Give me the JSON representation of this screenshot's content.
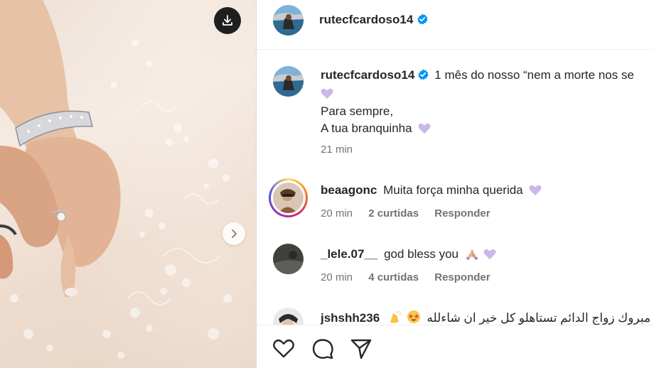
{
  "post": {
    "author": "rutecfcardoso14",
    "caption_line1": "1 mês do nosso “nem a morte nos se",
    "caption_line2": "Para sempre,",
    "caption_line3": "A tua branquinha",
    "time": "21 min"
  },
  "comments": [
    {
      "username": "beaagonc",
      "text": "Muita força minha querida",
      "time": "20 min",
      "likes": "2 curtidas",
      "reply": "Responder"
    },
    {
      "username": "_lele.07__",
      "text": "god bless you",
      "time": "20 min",
      "likes": "4 curtidas",
      "reply": "Responder"
    },
    {
      "username": "jshshh236",
      "text": "مبروك زواج الدائم تستاهلو كل خير ان شاءلله"
    }
  ],
  "icons": {
    "download": "download-icon",
    "next": "chevron-right-icon",
    "verified": "verified-badge-icon",
    "heart": "purple-heart-emoji",
    "like": "heart-outline-icon",
    "comment": "comment-bubble-icon",
    "share": "paper-plane-icon"
  },
  "colors": {
    "verified": "#0095f6",
    "purple_heart": "#c9b8e8",
    "meta_gray": "#737373"
  }
}
